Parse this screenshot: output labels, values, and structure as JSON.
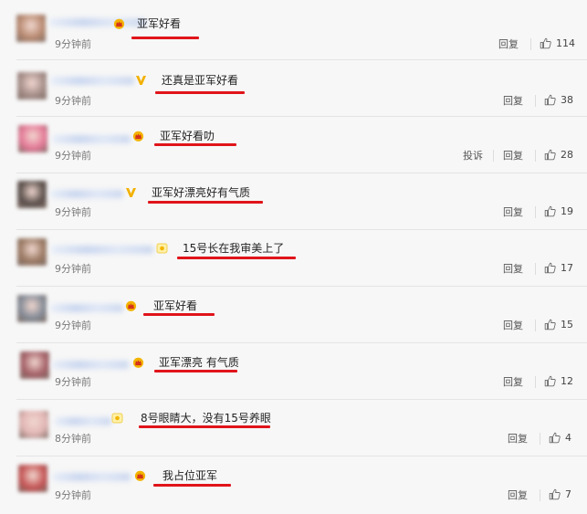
{
  "comments": [
    {
      "badge": "crown",
      "text": "亚军好看",
      "time": "9分钟前",
      "reply": "回复",
      "likes": "114",
      "avatar_color": "#b98b72"
    },
    {
      "badge": "v",
      "text": "还真是亚军好看",
      "time": "9分钟前",
      "reply": "回复",
      "likes": "38",
      "avatar_color": "#a78f8a"
    },
    {
      "badge": "crown",
      "text": "亚军好看叻",
      "time": "9分钟前",
      "report": "投诉",
      "reply": "回复",
      "likes": "28",
      "avatar_color": "#e57a98"
    },
    {
      "badge": "v",
      "text": "亚军好漂亮好有气质",
      "time": "9分钟前",
      "reply": "回复",
      "likes": "19",
      "avatar_color": "#5c514d"
    },
    {
      "badge": "sun",
      "text": "15号长在我审美上了",
      "time": "9分钟前",
      "reply": "回复",
      "likes": "17",
      "avatar_color": "#9b7a64"
    },
    {
      "badge": "crown",
      "text": "亚军好看",
      "time": "9分钟前",
      "reply": "回复",
      "likes": "15",
      "avatar_color": "#858c97"
    },
    {
      "badge": "crown",
      "text": "亚军漂亮 有气质",
      "time": "9分钟前",
      "reply": "回复",
      "likes": "12",
      "avatar_color": "#a56168"
    },
    {
      "badge": "sun",
      "text": "8号眼睛大，没有15号养眼",
      "time": "8分钟前",
      "reply": "回复",
      "likes": "4",
      "avatar_color": "#e2b7b5"
    },
    {
      "badge": "crown",
      "text": "我占位亚军",
      "time": "9分钟前",
      "reply": "回复",
      "likes": "7",
      "avatar_color": "#c55555"
    }
  ]
}
